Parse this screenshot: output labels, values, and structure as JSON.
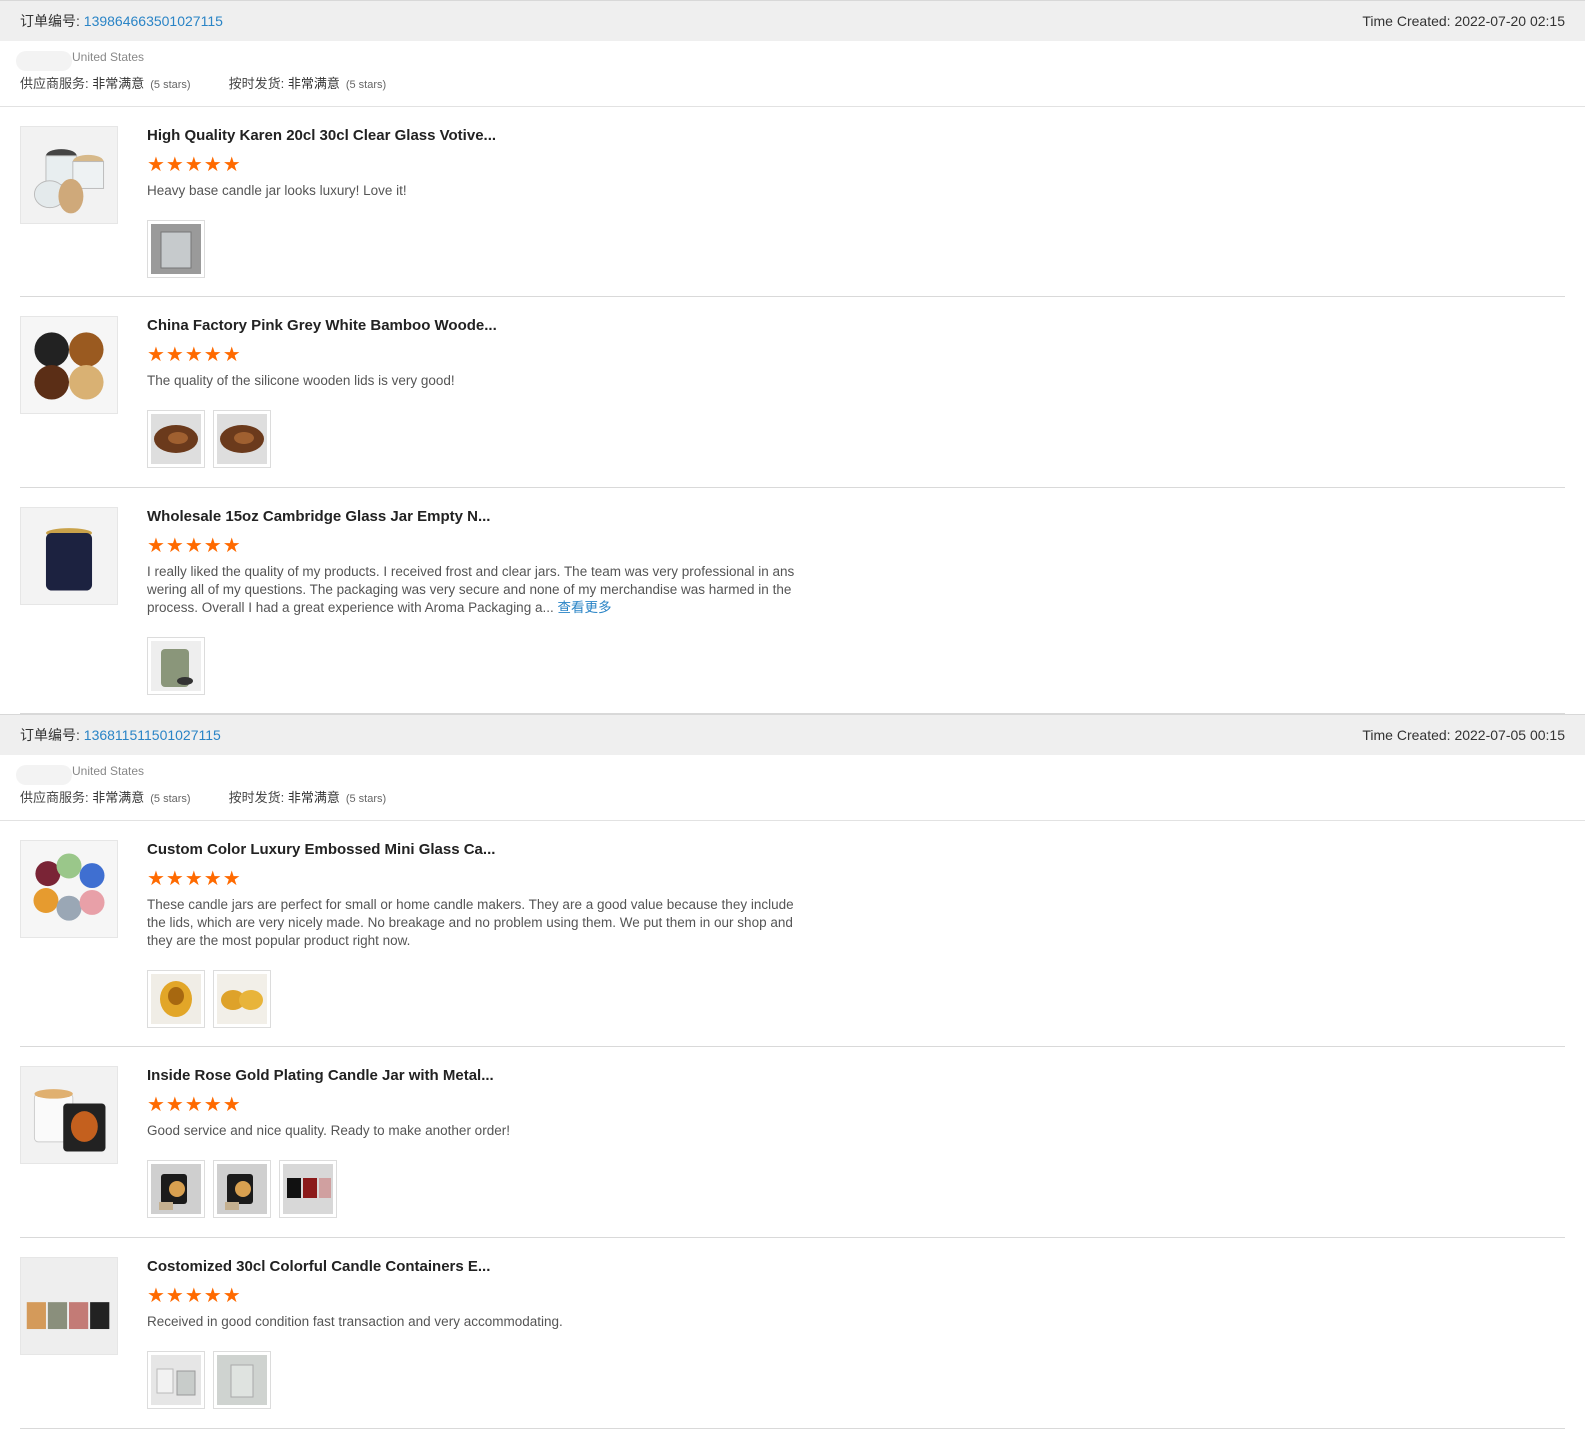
{
  "labels": {
    "order_no": "订单编号: ",
    "time_created": "Time Created: ",
    "supplier_service": "供应商服务: ",
    "on_time_delivery": "按时发货: ",
    "view_more": "查看更多"
  },
  "orders": [
    {
      "order_no": "139864663501027115",
      "time_created": "2022-07-20 02:15",
      "country": "United States",
      "supplier_service_level": "非常满意",
      "supplier_service_stars": "(5 stars)",
      "delivery_level": "非常满意",
      "delivery_stars": "(5 stars)",
      "reviews": [
        {
          "title": "High Quality Karen 20cl 30cl Clear Glass Votive...",
          "rating": 5,
          "stars": "★★★★★",
          "comment": "Heavy base candle jar looks luxury! Love it!",
          "thumb_icon": "clear-glass-jars-with-lids",
          "photos": [
            "clear-glass-jar-photo"
          ]
        },
        {
          "title": "China Factory Pink Grey White Bamboo Woode...",
          "rating": 5,
          "stars": "★★★★★",
          "comment": "The quality of the silicone wooden lids is very good!",
          "thumb_icon": "wooden-lids",
          "photos": [
            "wooden-lid-photo",
            "wooden-lid-photo"
          ]
        },
        {
          "title": "Wholesale 15oz Cambridge Glass Jar Empty N...",
          "rating": 5,
          "stars": "★★★★★",
          "comment": "I really liked the quality of my products. I received frost and clear jars. The team was very professional in answering all of my questions. The packaging was very secure and none of my merchandise was harmed in the process. Overall I had a great experience with Aroma Packaging a...",
          "has_more": true,
          "thumb_icon": "navy-glass-jar",
          "photos": [
            "frosted-green-jar-photo"
          ]
        }
      ]
    },
    {
      "order_no": "136811511501027115",
      "time_created": "2022-07-05 00:15",
      "country": "United States",
      "supplier_service_level": "非常满意",
      "supplier_service_stars": "(5 stars)",
      "delivery_level": "非常满意",
      "delivery_stars": "(5 stars)",
      "reviews": [
        {
          "title": "Custom Color Luxury Embossed Mini Glass Ca...",
          "rating": 5,
          "stars": "★★★★★",
          "comment": "These candle jars are perfect for small or home candle makers. They are a good value because they include the lids, which are very nicely made. No breakage and no problem using them. We put them in our shop and they are the most popular product right now.",
          "thumb_icon": "colorful-mini-jars",
          "photos": [
            "amber-mini-jar-photo",
            "amber-mini-jars-photo"
          ]
        },
        {
          "title": "Inside Rose Gold Plating Candle Jar with Metal...",
          "rating": 5,
          "stars": "★★★★★",
          "comment": "Good service and nice quality. Ready to make another order!",
          "thumb_icon": "rose-gold-jars",
          "photos": [
            "rose-gold-jar-photo",
            "rose-gold-jar-photo",
            "rose-gold-jars-photo"
          ]
        },
        {
          "title": "Costomized 30cl Colorful Candle Containers E...",
          "rating": 5,
          "stars": "★★★★★",
          "comment": "Received in good condition fast transaction and very accommodating.",
          "thumb_icon": "colorful-candle-containers",
          "photos": [
            "frosted-jars-photo",
            "frosted-jar-photo"
          ]
        }
      ]
    }
  ]
}
